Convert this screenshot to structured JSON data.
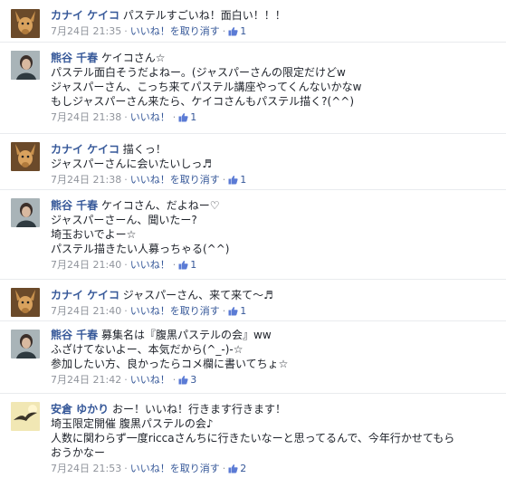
{
  "ui": {
    "like_icon": "thumbs-up-icon",
    "accent_color": "#365899",
    "meta_color": "#90949c"
  },
  "comments": [
    {
      "author": "カナイ ケイコ",
      "avatar": "dog-avatar",
      "lines": [
        "パステルすごいね！面白い！！！"
      ],
      "time": "7月24日 21:35",
      "action": "いいね！を取り消す",
      "likes": "1"
    },
    {
      "author": "熊谷 千春",
      "avatar": "person-avatar",
      "lines": [
        "ケイコさん☆",
        "パステル面白そうだよねー。(ジャスパーさんの限定だけどw",
        "ジャスパーさん、こっち来てパステル講座やってくんないかなw",
        "もしジャスパーさん来たら、ケイコさんもパステル描く?(^^)"
      ],
      "time": "7月24日 21:38",
      "action": "いいね！",
      "likes": "1"
    },
    {
      "author": "カナイ ケイコ",
      "avatar": "dog-avatar",
      "lines": [
        "描くっ！",
        "ジャスパーさんに会いたいしっ♬"
      ],
      "time": "7月24日 21:38",
      "action": "いいね！を取り消す",
      "likes": "1"
    },
    {
      "author": "熊谷 千春",
      "avatar": "person-avatar",
      "lines": [
        "ケイコさん、だよねー♡",
        "ジャスパーさーん、聞いたー?",
        "埼玉おいでよー☆",
        "パステル描きたい人募っちゃる(^^)"
      ],
      "time": "7月24日 21:40",
      "action": "いいね！",
      "likes": "1"
    },
    {
      "author": "カナイ ケイコ",
      "avatar": "dog-avatar",
      "lines": [
        "ジャスパーさん、来て来て〜♬"
      ],
      "time": "7月24日 21:40",
      "action": "いいね！を取り消す",
      "likes": "1"
    },
    {
      "author": "熊谷 千春",
      "avatar": "person-avatar",
      "lines": [
        "募集名は『腹黒パステルの会』ww",
        "ふざけてないよー、本気だから(^_-)-☆",
        "参加したい方、良かったらコメ欄に書いてちょ☆"
      ],
      "time": "7月24日 21:42",
      "action": "いいね！",
      "likes": "3"
    },
    {
      "author": "安倉 ゆかり",
      "avatar": "bird-avatar",
      "lines": [
        "おー！いいね！行きます行きます！",
        "埼玉限定開催 腹黒パステルの会♪",
        "人数に関わらず一度riccaさんちに行きたいなーと思ってるんで、今年行かせてもら",
        "おうかなー"
      ],
      "time": "7月24日 21:53",
      "action": "いいね！を取り消す",
      "likes": "2"
    }
  ]
}
